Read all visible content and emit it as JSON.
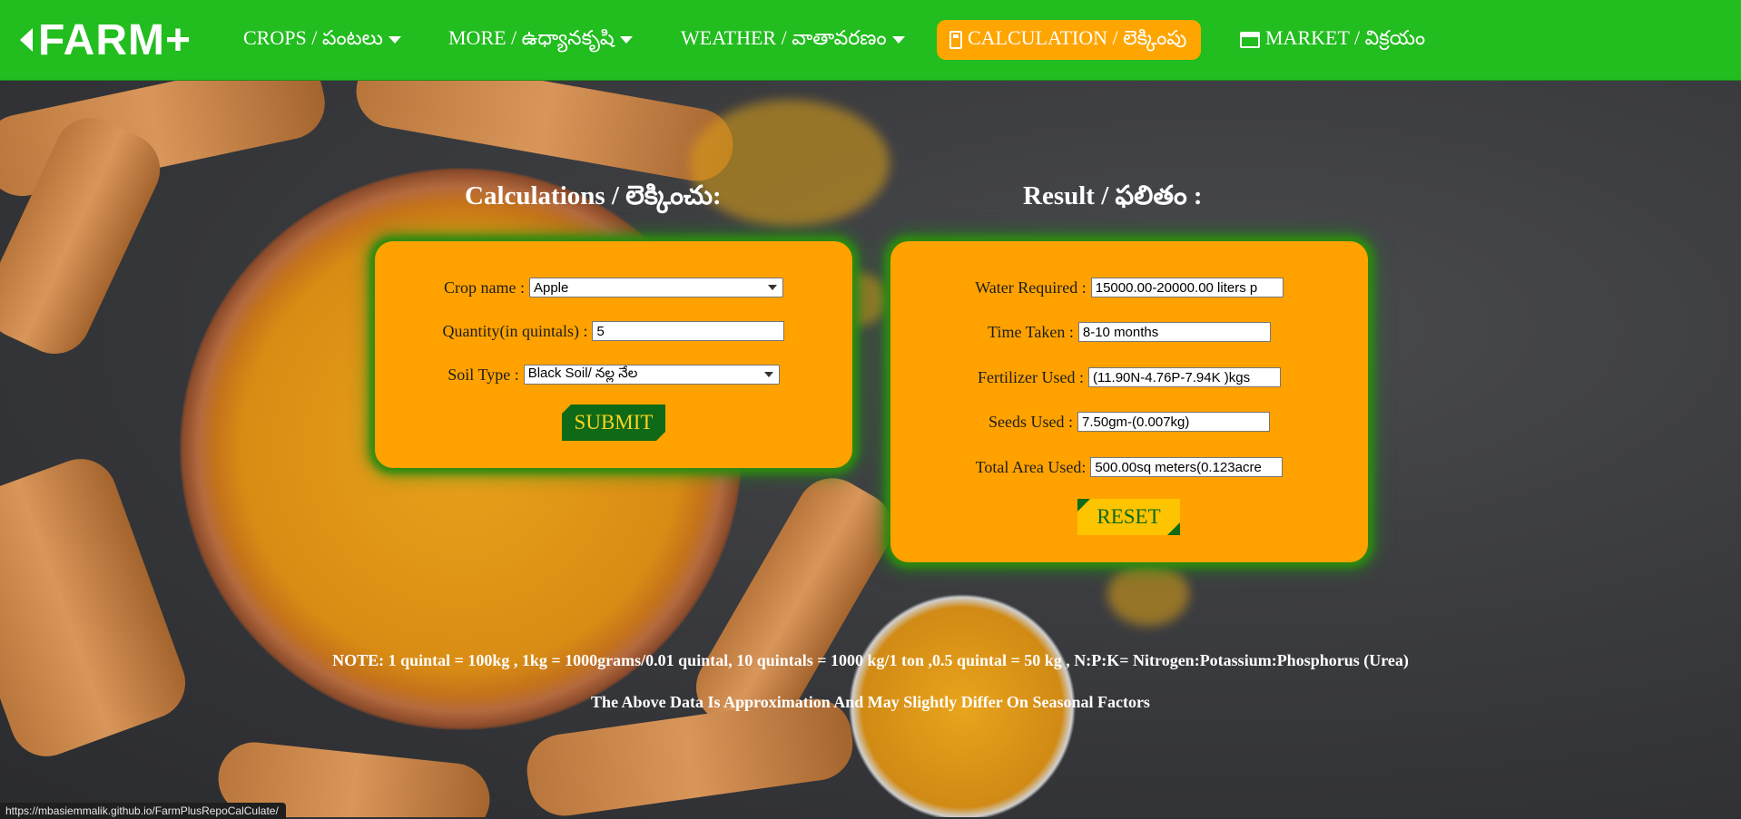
{
  "brand": {
    "logo_text": "FARM+"
  },
  "nav": {
    "crops": "CROPS / పంటలు",
    "more": "MORE / ఉధ్యానకృషి",
    "weather": "WEATHER / వాతావరణం",
    "calculation": "CALCULATION / లెక్కింపు",
    "market": "MARKET / విక్రయం"
  },
  "colors": {
    "nav_green": "#22bd1f",
    "active_orange": "#ffa500",
    "card_orange": "#ffa200",
    "button_green": "#0e6a16",
    "button_yellow": "#ffc400"
  },
  "calc": {
    "title": "Calculations / లెక్కించు:",
    "crop_label": "Crop name :",
    "crop_value": "Apple",
    "quantity_label": "Quantity(in quintals) :",
    "quantity_value": "5",
    "soil_label": "Soil Type :",
    "soil_value": "Black Soil/ నల్ల నేల",
    "submit": "SUBMIT"
  },
  "result": {
    "title": "Result / ఫలితం :",
    "water_label": "Water Required :",
    "water_value": "15000.00-20000.00 liters  p",
    "time_label": "Time Taken :",
    "time_value": "8-10 months",
    "fertilizer_label": "Fertilizer Used :",
    "fertilizer_value": "(11.90N-4.76P-7.94K )kgs",
    "seeds_label": "Seeds Used :",
    "seeds_value": "7.50gm-(0.007kg)",
    "area_label": "Total Area Used:",
    "area_value": "500.00sq meters(0.123acre",
    "reset": "RESET"
  },
  "notes": {
    "conversion": "NOTE: 1 quintal = 100kg , 1kg = 1000grams/0.01 quintal, 10 quintals = 1000 kg/1 ton ,0.5 quintal = 50 kg , N:P:K= Nitrogen:Potassium:Phosphorus (Urea)",
    "disclaimer": "The Above Data Is Approximation And May Slightly Differ On Seasonal Factors"
  },
  "status_bar": {
    "url": "https://mbasiemmalik.github.io/FarmPlusRepoCalCulate/"
  },
  "icons": {
    "calculation": "calculator-icon",
    "market": "store-icon",
    "dropdown": "caret-down-icon",
    "logo": "chevron-left-icon"
  }
}
